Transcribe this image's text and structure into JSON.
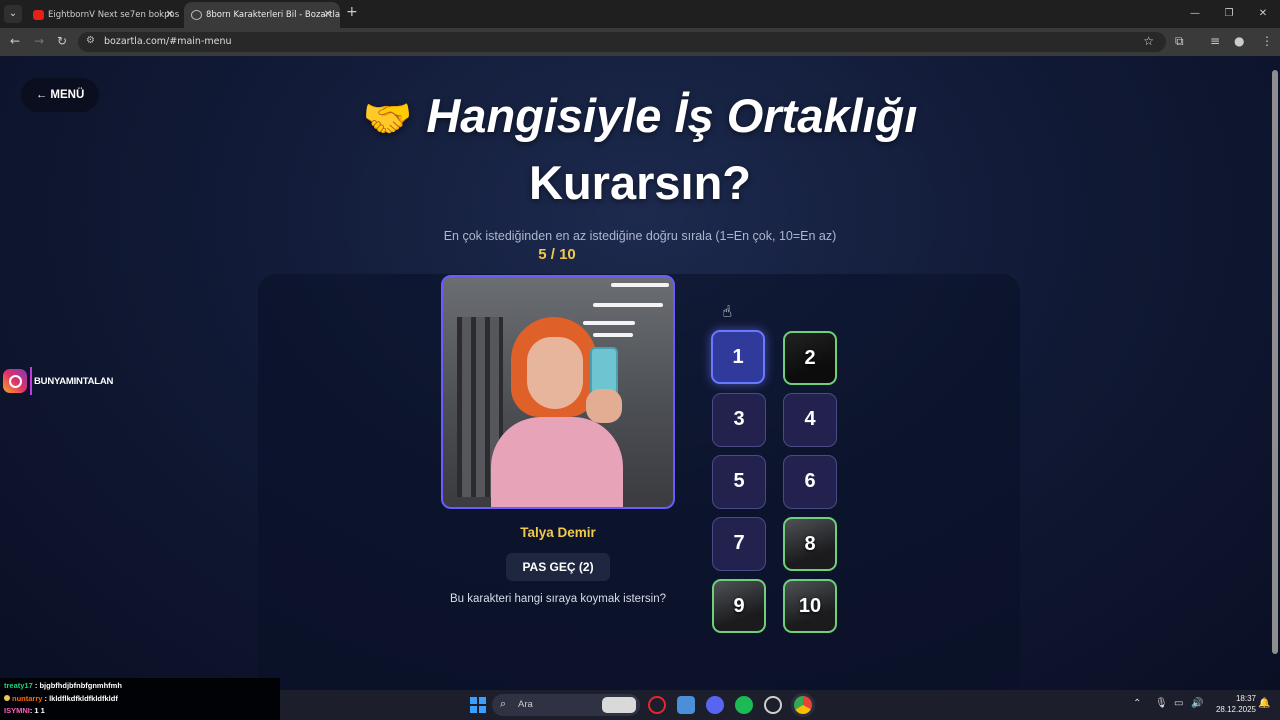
{
  "browser": {
    "tabs": [
      {
        "label": "EightbornV Next se7en bokpos",
        "favicon": "youtube-icon"
      },
      {
        "label": "8born Karakterleri Bil - Bozartla",
        "favicon": "globe-icon"
      }
    ],
    "url": "bozartla.com/#main-menu"
  },
  "page": {
    "menu_button": "← MENÜ",
    "title_line1": "Hangisiyle İş Ortaklığı",
    "title_line2": "Kurarsın?",
    "title_emoji": "🤝",
    "subtitle": "En çok istediğinden en az istediğine doğru sırala (1=En çok, 10=En az)",
    "counter": "5 / 10",
    "character_name": "Talya Demir",
    "skip_button": "PAS GEÇ (2)",
    "question": "Bu karakteri hangi sıraya koymak istersin?",
    "slots": [
      {
        "label": "1",
        "state": "active"
      },
      {
        "label": "2",
        "state": "filled"
      },
      {
        "label": "3",
        "state": "empty"
      },
      {
        "label": "4",
        "state": "empty"
      },
      {
        "label": "5",
        "state": "empty"
      },
      {
        "label": "6",
        "state": "empty"
      },
      {
        "label": "7",
        "state": "empty"
      },
      {
        "label": "8",
        "state": "filled"
      },
      {
        "label": "9",
        "state": "filled"
      },
      {
        "label": "10",
        "state": "filled"
      }
    ]
  },
  "overlay": {
    "instagram_handle": "BUNYAMINTALAN",
    "chat": [
      {
        "user": "treaty17",
        "message": ": bjgbfhdjbfnbfgnmhfmh"
      },
      {
        "user": "nuntarry",
        "message": ": lkldflkdfkldfkldfkldf"
      },
      {
        "user": "ISYMNI",
        "message": ": 1 1"
      }
    ]
  },
  "taskbar": {
    "search_placeholder": "Ara",
    "time": "18:37",
    "date": "28.12.2025"
  },
  "colors": {
    "accent_gold": "#f2c94c",
    "slot_active": "#6a78ff",
    "slot_filled_border": "#6fd07a",
    "page_bg": "#111a36"
  }
}
